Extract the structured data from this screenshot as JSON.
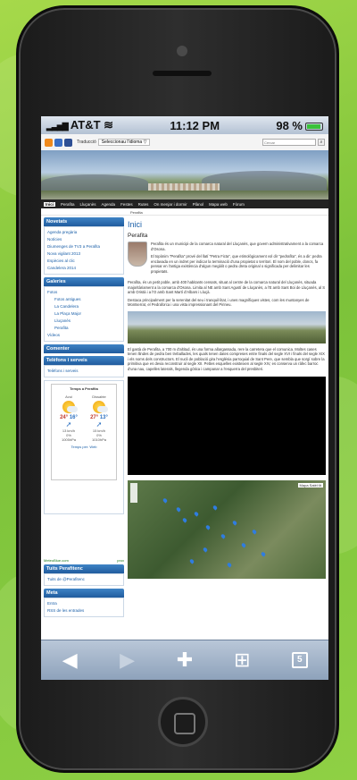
{
  "status_bar": {
    "carrier": "AT&T",
    "time": "11:12 PM",
    "battery": "98 %"
  },
  "site": {
    "translate_label": "Traducció",
    "translate_select": "Seleccionau l'idioma ▽",
    "search_placeholder": "Cercar",
    "nav": [
      "Inici",
      "Perafita",
      "Lluçanès",
      "Agenda",
      "Festes",
      "Rutes",
      "On menjar i dormir",
      "Plànol",
      "Mapa web",
      "Fòrum"
    ],
    "breadcrumb": "Perafita"
  },
  "sidebar": {
    "novetats": {
      "title": "Novetats",
      "items": [
        "Agenda pregària",
        "Notícies",
        "Diumenges de TV3 a Perafita",
        "Nova vigilant 2013",
        "Espècies al clic",
        "Candelera 2014"
      ]
    },
    "galeries": {
      "title": "Galeries",
      "items": [
        "Fotos",
        "Fotos antigues",
        "La Candelera",
        "La Plaça Major",
        "Lluçanès",
        "Perafita",
        "Vídeos"
      ]
    },
    "comenter": {
      "title": "Comenter"
    },
    "telefons": {
      "title": "Telèfons i serveis",
      "items": [
        "Telèfons i serveis"
      ]
    },
    "weather": {
      "title": "Temps a Perafita",
      "days": [
        {
          "name": "Avui",
          "max": "24°",
          "min": "16°",
          "wind": "13 km/h",
          "rain": "0%",
          "press": "1005hPa"
        },
        {
          "name": "Dissabte",
          "max": "27°",
          "min": "13°",
          "wind": "15 km/h",
          "rain": "0%",
          "press": "1010hPa"
        }
      ],
      "more": "Temps per: Web",
      "footer_left": "MeteoBlue.com",
      "footer_right": "prox"
    },
    "tuits": {
      "title": "Tuits Perafitenc",
      "items": [
        "Tuits de @Perafitenc"
      ]
    },
    "meta": {
      "title": "Meta",
      "items": [
        "Entra",
        "RSS de les entrades"
      ]
    }
  },
  "main": {
    "title": "Inici",
    "subtitle": "Perafita",
    "p1": "Perafita és un municipi de la comarca natural del Lluçanès, que govern administrativament a la comarca d'Osona.",
    "p2": "El topònim \"Perafita\" prové del llatí \"Petra Ficta\", que etimològicament vol dir \"pedrafita\", és a dir: pedra enclavada en un indret per indicar la terminació d'una propietat o territori. El nom del poble, doncs, fa pensar en l'antiga existència d'algun megàlit o pedra dreta original o significada per delimitar les propietats.",
    "p3": "Perafita, és un petit poble, amb 400 habitants censats, situat al centre de la comarca natural del Lluçanès, situada majoritàriament a la comarca d'Osona. Limita al NE amb Sant Agustí de Lluçanès, a l'E amb Sant Boi de Lluçanès, al S amb Oristà i a l'O amb Sant Martí d'Albars i Lluçà.",
    "p4": "Destaca principalment per la serenitat del seu i tranquil·litat, i unes magnífiques vistes, com les muntanyes de Montserrat, el Pedraforca i una vista impressionant del Pirineu.",
    "p5": "El gastà de Perafita, a 700 m d'altitud, és una forma allargassada, rere la carretera que el comunica. Moltes cases tenen llindes de pedra ben treballades, les quals tenen dates compreses entre finals del segle XVI i finals del segle XIX i els noms dels constructors. El nucli de població gira l'església parroquial de Sant Pere, que sembla que sorgí sobre la primitiva que es devia reconstruir al segle XII. Pettes esquelles existeixen al segle XIV, es conserva un ràfec barroc d'una nau, capelles laterals, llegenda gòtica i campanar a l'esquerra del presbiteri.",
    "map_type": "Mapa   Satèl·lit"
  }
}
